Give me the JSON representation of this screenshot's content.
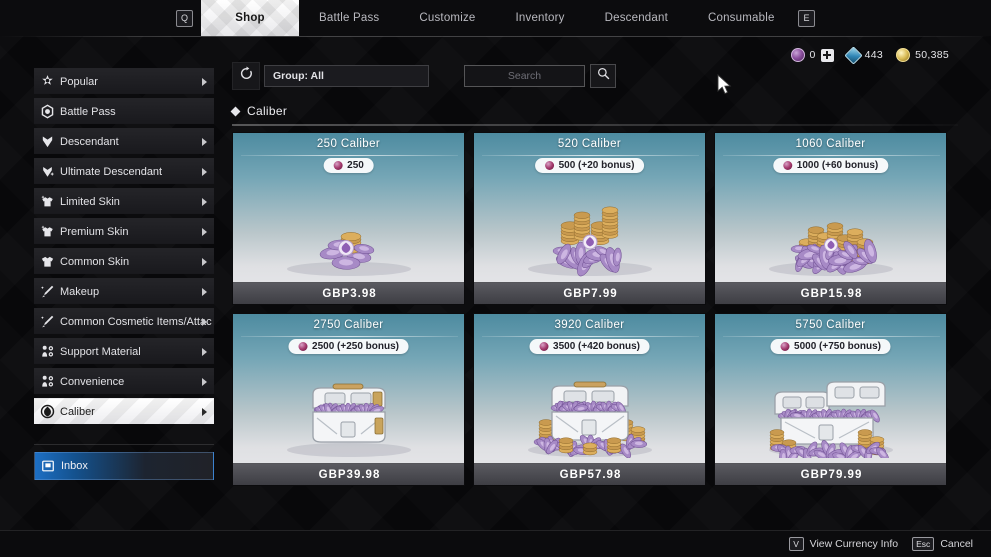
{
  "topbar": {
    "left_key": "Q",
    "right_key": "E",
    "tabs": [
      {
        "label": "Shop",
        "active": true
      },
      {
        "label": "Battle Pass",
        "active": false
      },
      {
        "label": "Customize",
        "active": false
      },
      {
        "label": "Inventory",
        "active": false
      },
      {
        "label": "Descendant",
        "active": false
      },
      {
        "label": "Consumable",
        "active": false
      }
    ]
  },
  "currency": [
    {
      "name": "caliber",
      "value": "0",
      "icon": "caliber-coin-icon",
      "has_plus": true
    },
    {
      "name": "gem",
      "value": "443",
      "icon": "blue-gem-icon",
      "has_plus": false
    },
    {
      "name": "gold",
      "value": "50,385",
      "icon": "gold-coin-icon",
      "has_plus": false
    }
  ],
  "sidebar": {
    "items": [
      {
        "label": "Popular",
        "icon": "star-burst-icon",
        "arrow": true,
        "selected": false
      },
      {
        "label": "Battle Pass",
        "icon": "hexagon-icon",
        "arrow": false,
        "selected": false
      },
      {
        "label": "Descendant",
        "icon": "crest-icon",
        "arrow": true,
        "selected": false
      },
      {
        "label": "Ultimate Descendant",
        "icon": "crest-sparkle-icon",
        "arrow": true,
        "selected": false
      },
      {
        "label": "Limited Skin",
        "icon": "shirt-sparkle-icon",
        "arrow": true,
        "selected": false
      },
      {
        "label": "Premium Skin",
        "icon": "shirt-sparkle-icon",
        "arrow": true,
        "selected": false
      },
      {
        "label": "Common Skin",
        "icon": "shirt-icon",
        "arrow": true,
        "selected": false
      },
      {
        "label": "Makeup",
        "icon": "brush-icon",
        "arrow": true,
        "selected": false
      },
      {
        "label": "Common Cosmetic Items/Attac",
        "icon": "brush-icon",
        "arrow": true,
        "selected": false
      },
      {
        "label": "Support Material",
        "icon": "module-icon",
        "arrow": true,
        "selected": false
      },
      {
        "label": "Convenience",
        "icon": "module-icon",
        "arrow": true,
        "selected": false
      },
      {
        "label": "Caliber",
        "icon": "caliber-shield-icon",
        "arrow": true,
        "selected": true
      }
    ],
    "inbox": {
      "label": "Inbox",
      "icon": "inbox-icon"
    }
  },
  "toolbar": {
    "refresh_icon": "refresh-icon",
    "group_label": "Group: All",
    "search_placeholder": "Search",
    "search_value": "",
    "search_icon": "magnifier-icon"
  },
  "section": {
    "title": "Caliber",
    "bullet_icon": "diamond-icon"
  },
  "products": [
    {
      "title": "250 Caliber",
      "amount": "250",
      "price": "GBP3.98",
      "art": "coins-small"
    },
    {
      "title": "520 Caliber",
      "amount": "500 (+20 bonus)",
      "price": "GBP7.99",
      "art": "coins-medium"
    },
    {
      "title": "1060 Caliber",
      "amount": "1000 (+60 bonus)",
      "price": "GBP15.98",
      "art": "coins-large"
    },
    {
      "title": "2750 Caliber",
      "amount": "2500 (+250 bonus)",
      "price": "GBP39.98",
      "art": "chest-small"
    },
    {
      "title": "3920 Caliber",
      "amount": "3500 (+420 bonus)",
      "price": "GBP57.98",
      "art": "chest-medium"
    },
    {
      "title": "5750 Caliber",
      "amount": "5000 (+750 bonus)",
      "price": "GBP79.99",
      "art": "chest-double"
    }
  ],
  "bottombar": {
    "hints": [
      {
        "key": "V",
        "label": "View Currency Info"
      },
      {
        "key": "Esc",
        "label": "Cancel"
      }
    ]
  },
  "colors": {
    "accent_caliber": "#a4396d",
    "card_top": "#4d8ba0",
    "card_bottom": "#e9e9ec",
    "inbox_blue": "#1d6fc4"
  }
}
